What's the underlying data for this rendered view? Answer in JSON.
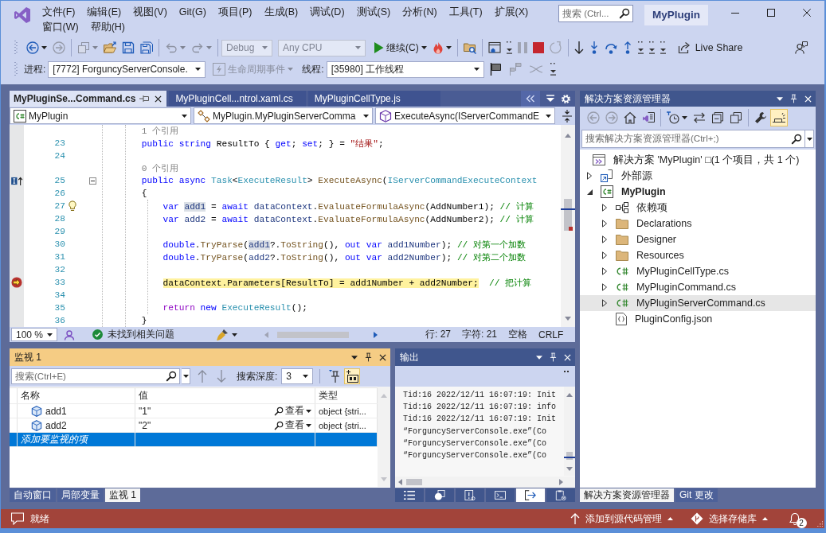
{
  "window": {
    "title": "MyPlugin",
    "search": {
      "placeholder": "搜索 (Ctrl..."
    }
  },
  "menu": [
    "文件(F)",
    "编辑(E)",
    "视图(V)",
    "Git(G)",
    "项目(P)",
    "生成(B)",
    "调试(D)",
    "测试(S)",
    "分析(N)",
    "工具(T)",
    "扩展(X)",
    "窗口(W)",
    "帮助(H)"
  ],
  "toolbar": [
    [
      {
        "kind": "back",
        "disabled": false,
        "dropdown": true
      },
      {
        "kind": "forward",
        "disabled": true,
        "dropdown": false
      }
    ],
    [
      {
        "kind": "new_item",
        "disabled": true,
        "dropdown": true
      },
      {
        "kind": "open",
        "disabled": false,
        "dropdown": false
      },
      {
        "kind": "save",
        "disabled": false,
        "dropdown": false
      },
      {
        "kind": "save_all",
        "disabled": false,
        "dropdown": false
      }
    ],
    [
      {
        "kind": "undo",
        "disabled": true,
        "dropdown": true
      },
      {
        "kind": "redo",
        "disabled": true,
        "dropdown": true
      }
    ],
    [
      {
        "kind": "combo",
        "value": "Debug",
        "disabled": true
      },
      {
        "kind": "combo",
        "value": "Any CPU",
        "disabled": true
      },
      {
        "kind": "run",
        "label": "继续(C)",
        "disabled": false,
        "dropdown": true
      },
      {
        "kind": "hot_reload",
        "disabled": false,
        "dropdown": true
      }
    ],
    [
      {
        "kind": "find_folder",
        "disabled": false,
        "dropdown": false
      }
    ],
    [
      {
        "kind": "window",
        "disabled": false,
        "dropdown": false
      },
      {
        "kind": "overflow",
        "disabled": false,
        "dropdown": false
      },
      {
        "kind": "pause",
        "disabled": true,
        "dropdown": false
      },
      {
        "kind": "stop",
        "disabled": false,
        "dropdown": false
      },
      {
        "kind": "restart",
        "disabled": true,
        "dropdown": false
      }
    ],
    [
      {
        "kind": "next_statement",
        "disabled": false,
        "dropdown": false
      },
      {
        "kind": "step_into",
        "disabled": false,
        "dropdown": false
      },
      {
        "kind": "step_over",
        "disabled": false,
        "dropdown": false
      },
      {
        "kind": "step_out",
        "disabled": false,
        "dropdown": false
      },
      {
        "kind": "overflow",
        "disabled": false,
        "dropdown": false
      },
      {
        "kind": "overflow",
        "disabled": false,
        "dropdown": false
      },
      {
        "kind": "overflow",
        "disabled": false,
        "dropdown": false
      },
      {
        "kind": "share",
        "label": "Live Share",
        "disabled": false,
        "dropdown": false
      }
    ],
    [
      {
        "kind": "feedback",
        "disabled": false,
        "dropdown": false
      }
    ]
  ],
  "debug_location": {
    "process_label": "进程:",
    "process": "[7772] ForguncyServerConsole.",
    "lifecycle": {
      "label": "生命周期事件",
      "disabled": true
    },
    "thread_label": "线程:",
    "thread": "[35980] 工作线程",
    "tools": [
      {
        "kind": "flag",
        "disabled": false
      },
      {
        "kind": "flag_threads",
        "disabled": true
      },
      {
        "kind": "swap",
        "disabled": true
      },
      {
        "kind": "overflow",
        "disabled": false
      }
    ]
  },
  "editor": {
    "tabs": [
      {
        "label": "MyPluginSe...Command.cs",
        "selected": true
      },
      {
        "label": "MyPluginCell...ntrol.xaml.cs",
        "selected": false
      },
      {
        "label": "MyPluginCellType.js",
        "selected": false
      }
    ],
    "nav": [
      {
        "kind": "project",
        "value": "MyPlugin"
      },
      {
        "kind": "class",
        "value": "MyPlugin.MyPluginServerComma"
      },
      {
        "kind": "method",
        "value": "ExecuteAsync(IServerCommandE"
      }
    ],
    "lines": [
      {
        "kind": "codelens",
        "text": "1 个引用"
      },
      {
        "kind": "code",
        "number": "23",
        "tokens": [
          {
            "kind": "keyword",
            "text": "public string"
          },
          {
            "kind": "plain",
            "text": " ResultTo { "
          },
          {
            "kind": "keyword",
            "text": "get"
          },
          {
            "kind": "plain",
            "text": "; "
          },
          {
            "kind": "keyword",
            "text": "set"
          },
          {
            "kind": "plain",
            "text": "; } = "
          },
          {
            "kind": "string",
            "text": "\"结果\""
          },
          {
            "kind": "plain",
            "text": ";"
          }
        ]
      },
      {
        "kind": "code",
        "number": "24"
      },
      {
        "kind": "codelens",
        "text": "0 个引用"
      },
      {
        "kind": "code",
        "number": "25",
        "glyph": {
          "kind": "implements"
        },
        "fold": {
          "kind": "collapse"
        },
        "tokens": [
          {
            "kind": "keyword",
            "text": "public async "
          },
          {
            "kind": "type",
            "text": "Task"
          },
          {
            "kind": "plain",
            "text": "<"
          },
          {
            "kind": "type",
            "text": "ExecuteResult"
          },
          {
            "kind": "plain",
            "text": "> "
          },
          {
            "kind": "method",
            "text": "ExecuteAsync"
          },
          {
            "kind": "plain",
            "text": "("
          },
          {
            "kind": "type",
            "text": "IServerCommandExecuteContext"
          }
        ]
      },
      {
        "kind": "code",
        "number": "26",
        "tokens": [
          {
            "kind": "plain",
            "text": "{"
          }
        ],
        "children": [
          {
            "kind": "code",
            "number": "27",
            "hint": {
              "kind": "lightbulb"
            },
            "tokens": [
              {
                "kind": "keyword",
                "text": "var "
              },
              {
                "kind": "highlight",
                "text": "add1"
              },
              {
                "kind": "plain",
                "text": " = "
              },
              {
                "kind": "keyword",
                "text": "await "
              },
              {
                "kind": "local",
                "text": "dataContext"
              },
              {
                "kind": "plain",
                "text": "."
              },
              {
                "kind": "method",
                "text": "EvaluateFormulaAsync"
              },
              {
                "kind": "plain",
                "text": "(AddNumber1); "
              },
              {
                "kind": "comment",
                "text": "// 计算"
              }
            ]
          },
          {
            "kind": "code",
            "number": "28",
            "tokens": [
              {
                "kind": "keyword",
                "text": "var "
              },
              {
                "kind": "local",
                "text": "add2"
              },
              {
                "kind": "plain",
                "text": " = "
              },
              {
                "kind": "keyword",
                "text": "await "
              },
              {
                "kind": "local",
                "text": "dataContext"
              },
              {
                "kind": "plain",
                "text": "."
              },
              {
                "kind": "method",
                "text": "EvaluateFormulaAsync"
              },
              {
                "kind": "plain",
                "text": "(AddNumber2); "
              },
              {
                "kind": "comment",
                "text": "// 计算"
              }
            ]
          },
          {
            "kind": "code",
            "number": "29"
          },
          {
            "kind": "code",
            "number": "30",
            "tokens": [
              {
                "kind": "keyword",
                "text": "double"
              },
              {
                "kind": "plain",
                "text": "."
              },
              {
                "kind": "method",
                "text": "TryParse"
              },
              {
                "kind": "plain",
                "text": "("
              },
              {
                "kind": "highlight",
                "text": "add1"
              },
              {
                "kind": "plain",
                "text": "?."
              },
              {
                "kind": "method",
                "text": "ToString"
              },
              {
                "kind": "plain",
                "text": "(), "
              },
              {
                "kind": "keyword",
                "text": "out var "
              },
              {
                "kind": "local",
                "text": "add1Number"
              },
              {
                "kind": "plain",
                "text": "); "
              },
              {
                "kind": "comment",
                "text": "// 对第一个加数"
              }
            ]
          },
          {
            "kind": "code",
            "number": "31",
            "tokens": [
              {
                "kind": "keyword",
                "text": "double"
              },
              {
                "kind": "plain",
                "text": "."
              },
              {
                "kind": "method",
                "text": "TryParse"
              },
              {
                "kind": "plain",
                "text": "("
              },
              {
                "kind": "local",
                "text": "add2"
              },
              {
                "kind": "plain",
                "text": "?."
              },
              {
                "kind": "method",
                "text": "ToString"
              },
              {
                "kind": "plain",
                "text": "(), "
              },
              {
                "kind": "keyword",
                "text": "out var "
              },
              {
                "kind": "local",
                "text": "add2Number"
              },
              {
                "kind": "plain",
                "text": "); "
              },
              {
                "kind": "comment",
                "text": "// 对第二个加数"
              }
            ]
          },
          {
            "kind": "code",
            "number": "32"
          },
          {
            "kind": "code",
            "number": "33",
            "glyph": {
              "kind": "current_statement"
            },
            "tokens": [
              {
                "kind": "current",
                "text": "dataContext.Parameters[ResultTo] = add1Number + add2Number;"
              },
              {
                "kind": "comment",
                "text": "  // 把计算"
              }
            ]
          },
          {
            "kind": "code",
            "number": "34"
          },
          {
            "kind": "code",
            "number": "35",
            "tokens": [
              {
                "kind": "control",
                "text": "return "
              },
              {
                "kind": "keyword",
                "text": "new "
              },
              {
                "kind": "type",
                "text": "ExecuteResult"
              },
              {
                "kind": "plain",
                "text": "();"
              }
            ]
          }
        ]
      },
      {
        "kind": "code",
        "number": "36",
        "tokens": [
          {
            "kind": "plain",
            "text": "}"
          }
        ]
      }
    ],
    "status": {
      "zoom": "100 %",
      "issues": "未找到相关问题",
      "line": "行: 27",
      "column": "字符: 21",
      "whitespace": "空格",
      "line_ending": "CRLF"
    }
  },
  "watch": {
    "title": "监视 1",
    "active": true,
    "search": {
      "placeholder": "搜索(Ctrl+E)"
    },
    "search_nav": [
      {
        "kind": "up",
        "disabled": true
      },
      {
        "kind": "down",
        "disabled": true
      }
    ],
    "depth_label": "搜索深度:",
    "depth": "3",
    "toggles": [
      {
        "kind": "pin_filter",
        "on": false
      },
      {
        "kind": "ab",
        "on": true
      }
    ],
    "columns": [
      "名称",
      "值",
      "类型"
    ],
    "rows": [
      {
        "kind": "variable",
        "name": "add1",
        "value": "\"1\"",
        "view": "查看",
        "type": "object {stri...",
        "selected": false
      },
      {
        "kind": "variable",
        "name": "add2",
        "value": "\"2\"",
        "view": "查看",
        "type": "object {stri...",
        "selected": false
      },
      {
        "kind": "add_new",
        "name": "添加要监视的项",
        "selected": true
      }
    ],
    "tabs": [
      {
        "label": "自动窗口",
        "selected": false
      },
      {
        "label": "局部变量",
        "selected": false
      },
      {
        "label": "监视 1",
        "selected": true
      }
    ]
  },
  "output": {
    "title": "输出",
    "active": false,
    "lines": [
      "Tid:16 2022/12/11 16:07:19: Init",
      "Tid:16 2022/12/11 16:07:19: info",
      "Tid:16 2022/12/11 16:07:19: Init",
      "“ForguncyServerConsole.exe”(Co",
      "“ForguncyServerConsole.exe”(Co",
      "“ForguncyServerConsole.exe”(Co"
    ],
    "tabs": [
      {
        "kind": "task_list",
        "selected": false
      },
      {
        "kind": "call_stack",
        "selected": false
      },
      {
        "kind": "error_list",
        "selected": false
      },
      {
        "kind": "terminal",
        "selected": false
      },
      {
        "kind": "output",
        "selected": true
      },
      {
        "kind": "clipboard",
        "selected": false
      }
    ]
  },
  "solution_explorer": {
    "title": "解决方案资源管理器",
    "active": false,
    "tools": [
      [
        {
          "kind": "back",
          "disabled": true,
          "dropdown": false,
          "on": false
        },
        {
          "kind": "forward",
          "disabled": true,
          "dropdown": false,
          "on": false
        },
        {
          "kind": "home",
          "disabled": false,
          "dropdown": false,
          "on": false
        },
        {
          "kind": "switch_views",
          "disabled": false,
          "dropdown": false,
          "on": false
        }
      ],
      [
        {
          "kind": "history",
          "disabled": false,
          "dropdown": true,
          "on": false
        },
        {
          "kind": "sync",
          "disabled": false,
          "dropdown": false,
          "on": false
        },
        {
          "kind": "collapse",
          "disabled": false,
          "dropdown": false,
          "on": false
        },
        {
          "kind": "show_all",
          "disabled": false,
          "dropdown": false,
          "on": false
        }
      ],
      [
        {
          "kind": "properties",
          "disabled": false,
          "dropdown": false,
          "on": false
        },
        {
          "kind": "preview",
          "disabled": false,
          "dropdown": false,
          "on": true
        }
      ]
    ],
    "search": {
      "placeholder": "搜索解决方案资源管理器(Ctrl+;)"
    },
    "tree": [
      {
        "kind": "solution",
        "label": "解决方案 'MyPlugin' □(1 个项目，共 1 个)",
        "selected": false,
        "children": [
          {
            "kind": "external",
            "label": "外部源",
            "expanded": false,
            "selected": false
          },
          {
            "kind": "project",
            "label": "MyPlugin",
            "expanded": true,
            "selected": false,
            "children": [
              {
                "kind": "dependencies",
                "label": "依赖项",
                "expanded": false,
                "selected": false
              },
              {
                "kind": "folder",
                "label": "Declarations",
                "expanded": false,
                "selected": false
              },
              {
                "kind": "folder",
                "label": "Designer",
                "expanded": false,
                "selected": false
              },
              {
                "kind": "folder",
                "label": "Resources",
                "expanded": false,
                "selected": false
              },
              {
                "kind": "csharp",
                "label": "MyPluginCellType.cs",
                "expanded": false,
                "selected": false
              },
              {
                "kind": "csharp",
                "label": "MyPluginCommand.cs",
                "expanded": false,
                "selected": false
              },
              {
                "kind": "csharp",
                "label": "MyPluginServerCommand.cs",
                "expanded": false,
                "selected": true
              },
              {
                "kind": "json",
                "label": "PluginConfig.json",
                "selected": false
              }
            ]
          }
        ]
      }
    ],
    "tabs": [
      {
        "label": "解决方案资源管理器",
        "selected": true
      },
      {
        "label": "Git 更改",
        "selected": false
      }
    ]
  },
  "status_bar": {
    "message": "就绪",
    "items": [
      {
        "kind": "source_control",
        "label": "添加到源代码管理"
      },
      {
        "kind": "repository",
        "label": "选择存储库"
      }
    ],
    "notifications": "2"
  }
}
